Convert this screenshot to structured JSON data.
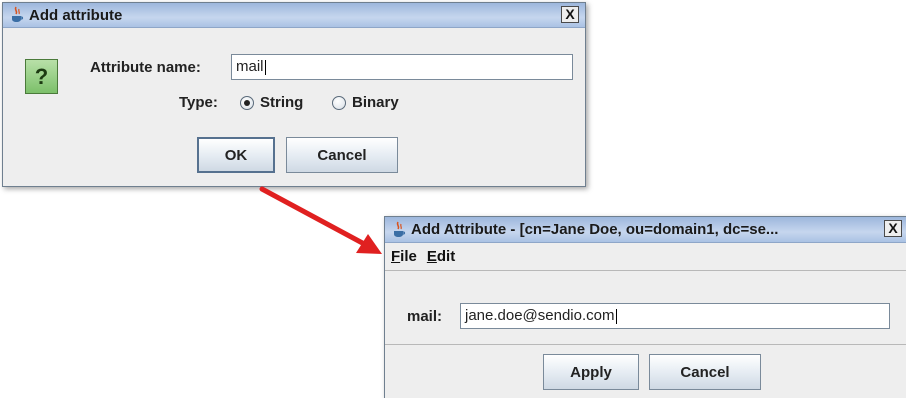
{
  "dialog1": {
    "title": "Add attribute",
    "close_label": "X",
    "question_glyph": "?",
    "attribute_name_label": "Attribute name:",
    "attribute_name_value": "mail",
    "type_label": "Type:",
    "type_options": [
      "String",
      "Binary"
    ],
    "type_selected": "String",
    "ok_label": "OK",
    "cancel_label": "Cancel"
  },
  "dialog2": {
    "title": "Add Attribute - [cn=Jane Doe, ou=domain1, dc=se...",
    "close_label": "X",
    "menu": [
      "File",
      "Edit"
    ],
    "field_label": "mail:",
    "field_value": "jane.doe@sendio.com",
    "apply_label": "Apply",
    "cancel_label": "Cancel"
  },
  "colors": {
    "arrow": "#e02020",
    "titlebar": "#b6cbe8",
    "dialog_bg": "#eeeeee",
    "question_icon": "#8fcc7a"
  },
  "icons": [
    "java-cup-icon",
    "question-icon",
    "close-icon",
    "arrow-icon"
  ]
}
